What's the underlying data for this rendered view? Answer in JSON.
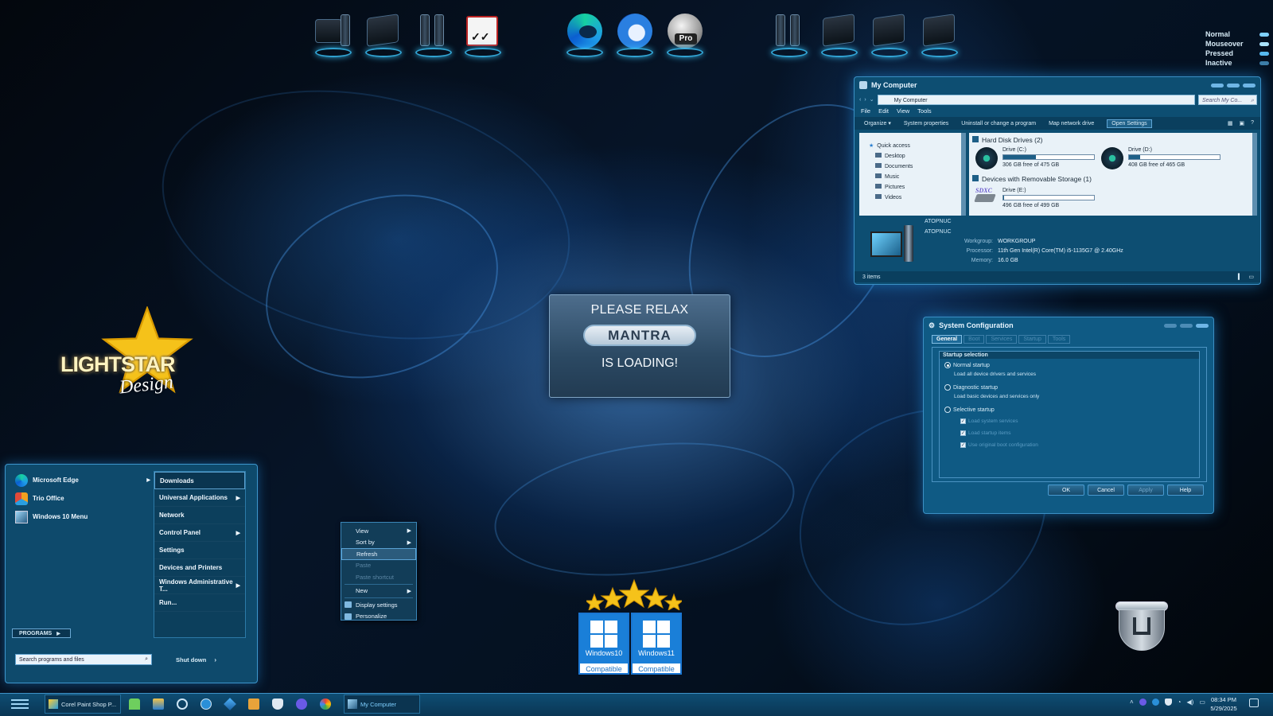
{
  "legend": {
    "items": [
      {
        "label": "Normal",
        "color": "#7fd0ff"
      },
      {
        "label": "Mouseover",
        "color": "#a9e3ff"
      },
      {
        "label": "Pressed",
        "color": "#56b9f0"
      },
      {
        "label": "Inactive",
        "color": "#3d7ea8"
      }
    ]
  },
  "desktop_icons": {
    "pro_label": "Pro"
  },
  "logo": {
    "text": "LIGHTSTAR",
    "script": "Design"
  },
  "splash": {
    "line1": "PLEASE RELAX",
    "button": "MANTRA",
    "line2": "IS LOADING!"
  },
  "badges": {
    "win10_name": "Windows10",
    "win10_sub": "Compatible",
    "win11_name": "Windows11",
    "win11_sub": "Compatible"
  },
  "explorer": {
    "title": "My Computer",
    "address": "My Computer",
    "search_placeholder": "Search My Co...",
    "menu": [
      "File",
      "Edit",
      "View",
      "Tools"
    ],
    "toolbar": {
      "organize": "Organize",
      "system_properties": "System properties",
      "uninstall": "Uninstall or change a program",
      "map_drive": "Map network drive",
      "open_settings": "Open Settings"
    },
    "nav": {
      "quick_access": "Quick access",
      "items": [
        "Desktop",
        "Documents",
        "Music",
        "Pictures",
        "Videos"
      ]
    },
    "groups": {
      "hdd": "Hard Disk Drives (2)",
      "removable": "Devices with Removable Storage (1)"
    },
    "drives": [
      {
        "name": "Drive (C:)",
        "free": "306 GB free of 475 GB",
        "used_fraction": 0.36
      },
      {
        "name": "Drive (D:)",
        "free": "408 GB free of 465 GB",
        "used_fraction": 0.12
      },
      {
        "name": "Drive (E:)",
        "free": "496 GB free of 499 GB",
        "used_fraction": 0.01,
        "label": "SDXC"
      }
    ],
    "details": {
      "name1": "ATOPNUC",
      "name2": "ATOPNUC",
      "workgroup_label": "Workgroup:",
      "workgroup": "WORKGROUP",
      "processor_label": "Processor:",
      "processor": "11th Gen Intel(R) Core(TM) i5-1135G7 @ 2.40GHz",
      "memory_label": "Memory:",
      "memory": "16.0 GB"
    },
    "status": "3 items"
  },
  "sysconfig": {
    "title": "System Configuration",
    "tabs": [
      "General",
      "Boot",
      "Services",
      "Startup",
      "Tools"
    ],
    "group_title": "Startup selection",
    "normal": "Normal startup",
    "normal_desc": "Load all device drivers and services",
    "diagnostic": "Diagnostic startup",
    "diagnostic_desc": "Load basic devices and services only",
    "selective": "Selective startup",
    "checks": [
      "Load system services",
      "Load startup items",
      "Use original boot configuration"
    ],
    "buttons": {
      "ok": "OK",
      "cancel": "Cancel",
      "apply": "Apply",
      "help": "Help"
    }
  },
  "start_menu": {
    "left_items": [
      "Microsoft Edge",
      "Trio Office",
      "Windows 10 Menu"
    ],
    "right_items": [
      {
        "label": "Downloads",
        "arrow": false
      },
      {
        "label": "Universal Applications",
        "arrow": true
      },
      {
        "label": "Network",
        "arrow": false
      },
      {
        "label": "Control Panel",
        "arrow": true
      },
      {
        "label": "Settings",
        "arrow": false
      },
      {
        "label": "Devices and Printers",
        "arrow": false
      },
      {
        "label": "Windows Administrative T...",
        "arrow": true
      },
      {
        "label": "Run...",
        "arrow": false
      }
    ],
    "programs": "PROGRAMS",
    "search_placeholder": "Search programs and files",
    "shutdown": "Shut down"
  },
  "context_menu": {
    "items": [
      {
        "label": "View",
        "arrow": true,
        "state": "normal"
      },
      {
        "label": "Sort by",
        "arrow": true,
        "state": "normal"
      },
      {
        "label": "Refresh",
        "arrow": false,
        "state": "highlight"
      },
      {
        "label": "Paste",
        "arrow": false,
        "state": "disabled"
      },
      {
        "label": "Paste shortcut",
        "arrow": false,
        "state": "disabled"
      },
      {
        "label": "New",
        "arrow": true,
        "state": "normal"
      },
      {
        "label": "Display settings",
        "arrow": false,
        "state": "normal"
      },
      {
        "label": "Personalize",
        "arrow": false,
        "state": "normal"
      }
    ]
  },
  "taskbar": {
    "app1": "Corel Paint Shop P...",
    "app2": "My Computer",
    "time": "08:34 PM",
    "date": "5/29/2025"
  }
}
